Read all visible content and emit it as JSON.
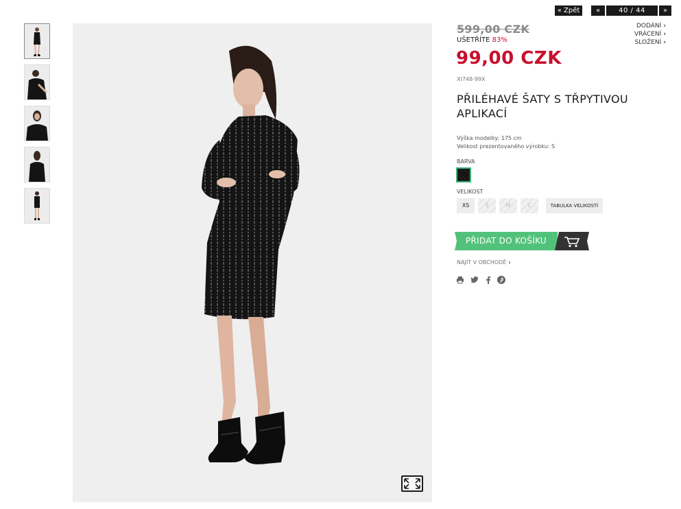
{
  "nav": {
    "back_label": "« Zpět",
    "prev_label": "«",
    "next_label": "»",
    "counter": "40 / 44"
  },
  "side_links": [
    "DODÁNÍ",
    "VRÁCENÍ",
    "SLOŽENÍ"
  ],
  "thumbnails": [
    "thumb-1",
    "thumb-2",
    "thumb-3",
    "thumb-4",
    "thumb-5"
  ],
  "product": {
    "old_price": "599,00 CZK",
    "save_label": "UŠETŘÍTE",
    "save_pct": "83%",
    "price": "99,00 CZK",
    "sku": "XI748-99X",
    "title": "PŘILÉHAVÉ ŠATY S TŘPYTIVOU APLIKACÍ",
    "model_height": "Výška modelky: 175 cm",
    "model_size": "Velikost prezentovaného výrobku: S",
    "color_label": "BARVA",
    "size_label": "VELIKOST",
    "sizes": [
      {
        "label": "XS",
        "available": true
      },
      {
        "label": "S",
        "available": false
      },
      {
        "label": "M",
        "available": false
      },
      {
        "label": "L",
        "available": false
      }
    ],
    "size_chart_label": "TABULKA VELIKOSTÍ",
    "add_to_cart_label": "PŘIDAT DO KOŠÍKU",
    "find_store_label": "NAJÍT V OBCHODĚ"
  },
  "colors": {
    "accent_green": "#52c27b",
    "price_red": "#c8102e"
  },
  "icons": [
    "print-icon",
    "twitter-icon",
    "facebook-icon",
    "pinterest-icon",
    "cart-icon",
    "expand-icon"
  ]
}
